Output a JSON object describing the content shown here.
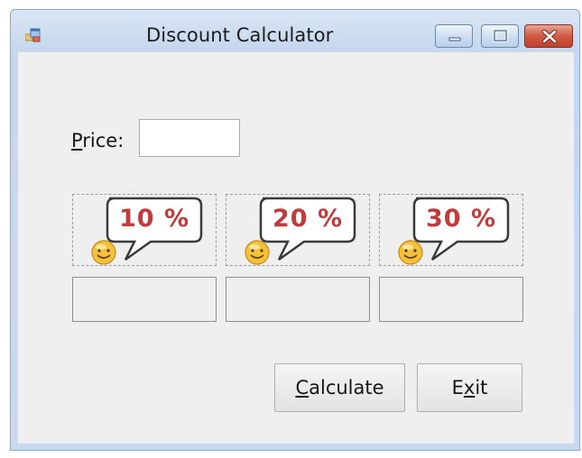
{
  "window": {
    "title": "Discount Calculator",
    "controls": [
      "minimize",
      "maximize",
      "close"
    ]
  },
  "price": {
    "label_accel": "P",
    "label_rest": "rice:",
    "value": ""
  },
  "discounts": [
    {
      "label": "10 %",
      "icon": "smiley-speech-bubble-icon",
      "result": ""
    },
    {
      "label": "20 %",
      "icon": "smiley-speech-bubble-icon",
      "result": ""
    },
    {
      "label": "30 %",
      "icon": "smiley-speech-bubble-icon",
      "result": ""
    }
  ],
  "buttons": {
    "calculate": {
      "accel": "C",
      "rest": "alculate"
    },
    "exit": {
      "pre": "E",
      "accel": "x",
      "post": "it"
    }
  },
  "colors": {
    "percent_text": "#c23b3b",
    "close_button": "#c9482f"
  }
}
